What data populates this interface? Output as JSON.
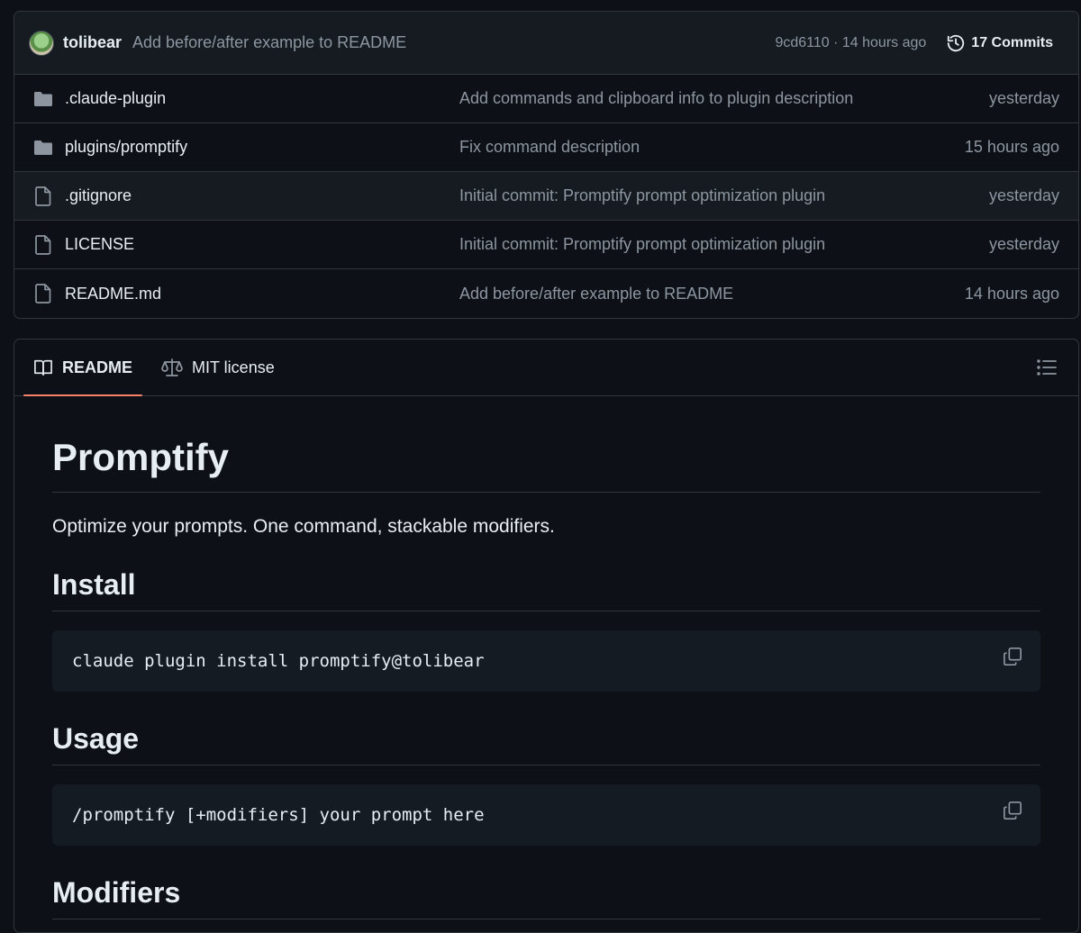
{
  "commit_bar": {
    "author": "tolibear",
    "message": "Add before/after example to README",
    "sha_time": "9cd6110 · 14 hours ago",
    "commits_label": "17 Commits"
  },
  "files": [
    {
      "type": "folder",
      "name": ".claude-plugin",
      "message": "Add commands and clipboard info to plugin description",
      "time": "yesterday"
    },
    {
      "type": "folder",
      "name": "plugins/promptify",
      "message": "Fix command description",
      "time": "15 hours ago"
    },
    {
      "type": "file",
      "name": ".gitignore",
      "message": "Initial commit: Promptify prompt optimization plugin",
      "time": "yesterday"
    },
    {
      "type": "file",
      "name": "LICENSE",
      "message": "Initial commit: Promptify prompt optimization plugin",
      "time": "yesterday"
    },
    {
      "type": "file",
      "name": "README.md",
      "message": "Add before/after example to README",
      "time": "14 hours ago"
    }
  ],
  "tabs": {
    "readme": "README",
    "license": "MIT license"
  },
  "readme": {
    "title": "Promptify",
    "intro": "Optimize your prompts. One command, stackable modifiers.",
    "install_heading": "Install",
    "install_code": "claude plugin install promptify@tolibear",
    "usage_heading": "Usage",
    "usage_code": "/promptify [+modifiers] your prompt here",
    "modifiers_heading": "Modifiers"
  },
  "colors": {
    "background": "#0d1117",
    "accent_tab": "#f78166",
    "border": "#30363d"
  }
}
